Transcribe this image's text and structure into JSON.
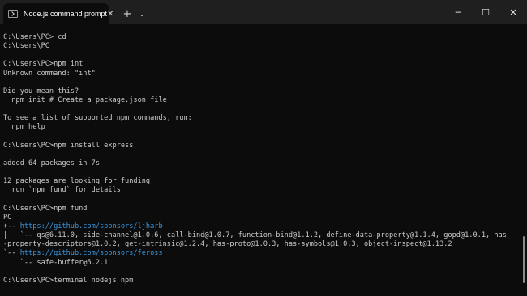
{
  "titlebar": {
    "tab_title": "Node.js command prompt",
    "tab_close": "✕",
    "new_tab": "+",
    "dropdown": "⌄",
    "minimize": "─",
    "maximize": "☐",
    "close": "✕"
  },
  "terminal": {
    "lines": [
      "C:\\Users\\PC> cd",
      "C:\\Users\\PC",
      "",
      "C:\\Users\\PC>npm int",
      "Unknown command: \"int\"",
      "",
      "Did you mean this?",
      "  npm init # Create a package.json file",
      "",
      "To see a list of supported npm commands, run:",
      "  npm help",
      "",
      "C:\\Users\\PC>npm install express",
      "",
      "added 64 packages in 7s",
      "",
      "12 packages are looking for funding",
      "  run `npm fund` for details",
      "",
      "C:\\Users\\PC>npm fund",
      "PC"
    ],
    "fund_line1_prefix": "+-- ",
    "fund_line1_link": "https://github.com/sponsors/ljharb",
    "fund_line2": "|   `-- qs@6.11.0, side-channel@1.0.6, call-bind@1.0.7, function-bind@1.1.2, define-data-property@1.1.4, gopd@1.0.1, has",
    "fund_line3": "-property-descriptors@1.0.2, get-intrinsic@1.2.4, has-proto@1.0.3, has-symbols@1.0.3, object-inspect@1.13.2",
    "fund_line4_prefix": "`-- ",
    "fund_line4_link": "https://github.com/sponsors/feross",
    "fund_line5": "    `-- safe-buffer@5.2.1",
    "prompt": "C:\\Users\\PC>terminal nodejs npm"
  },
  "colors": {
    "background": "#0c0c0c",
    "titlebar": "#1f1f1f",
    "text": "#cccccc",
    "link": "#3a96dd"
  }
}
